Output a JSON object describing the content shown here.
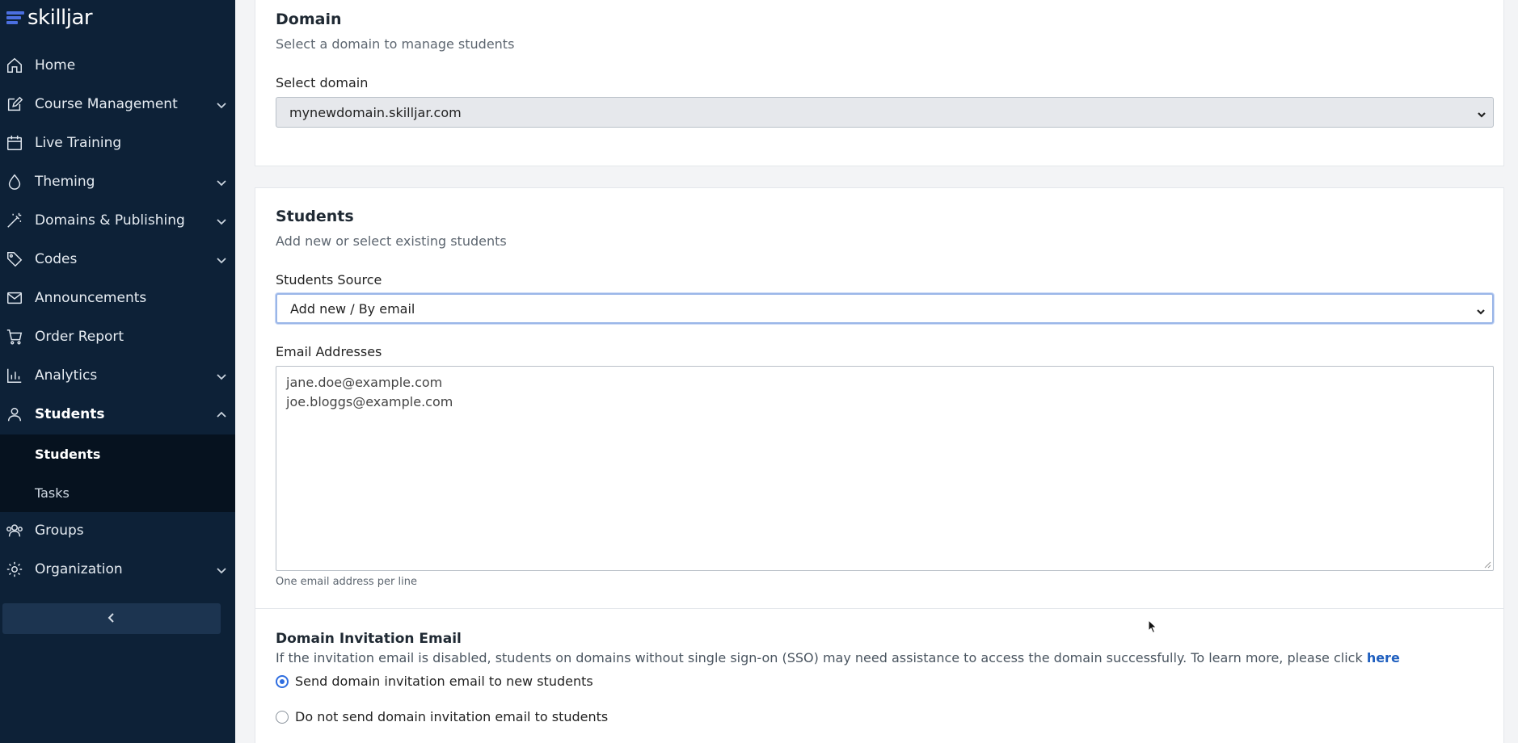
{
  "brand": {
    "name": "skilljar"
  },
  "sidebar": {
    "items": [
      {
        "label": "Home",
        "icon": "home-icon",
        "expandable": false
      },
      {
        "label": "Course Management",
        "icon": "edit-icon",
        "expandable": true
      },
      {
        "label": "Live Training",
        "icon": "calendar-icon",
        "expandable": false
      },
      {
        "label": "Theming",
        "icon": "droplet-icon",
        "expandable": true
      },
      {
        "label": "Domains & Publishing",
        "icon": "wand-icon",
        "expandable": true
      },
      {
        "label": "Codes",
        "icon": "tag-icon",
        "expandable": true
      },
      {
        "label": "Announcements",
        "icon": "mail-icon",
        "expandable": false
      },
      {
        "label": "Order Report",
        "icon": "cart-icon",
        "expandable": false
      },
      {
        "label": "Analytics",
        "icon": "bar-chart-icon",
        "expandable": true
      },
      {
        "label": "Students",
        "icon": "user-icon",
        "expandable": true,
        "expanded": true
      },
      {
        "label": "Groups",
        "icon": "users-icon",
        "expandable": false
      },
      {
        "label": "Organization",
        "icon": "gear-icon",
        "expandable": true
      }
    ],
    "students_sub": [
      {
        "label": "Students",
        "active": true
      },
      {
        "label": "Tasks",
        "active": false
      }
    ]
  },
  "domain_section": {
    "title": "Domain",
    "subtitle": "Select a domain to manage students",
    "select_label": "Select domain",
    "selected_domain": "mynewdomain.skilljar.com"
  },
  "students_section": {
    "title": "Students",
    "subtitle": "Add new or select existing students",
    "source_label": "Students Source",
    "source_value": "Add new / By email",
    "emails_label": "Email Addresses",
    "emails": [
      "jane.doe@example.com",
      "joe.bloggs@example.com"
    ],
    "emails_help": "One email address per line"
  },
  "invitation_section": {
    "title": "Domain Invitation Email",
    "description": "If the invitation email is disabled, students on domains without single sign-on (SSO) may need assistance to access the domain successfully. To learn more, please click",
    "link_text": "here",
    "options": [
      {
        "label": "Send domain invitation email to new students",
        "selected": true
      },
      {
        "label": "Do not send domain invitation email to students",
        "selected": false
      }
    ]
  },
  "colors": {
    "sidebar_bg": "#0d2137",
    "subnav_bg": "#06121f",
    "accent": "#2f6ee0",
    "link": "#1f5fbf"
  }
}
